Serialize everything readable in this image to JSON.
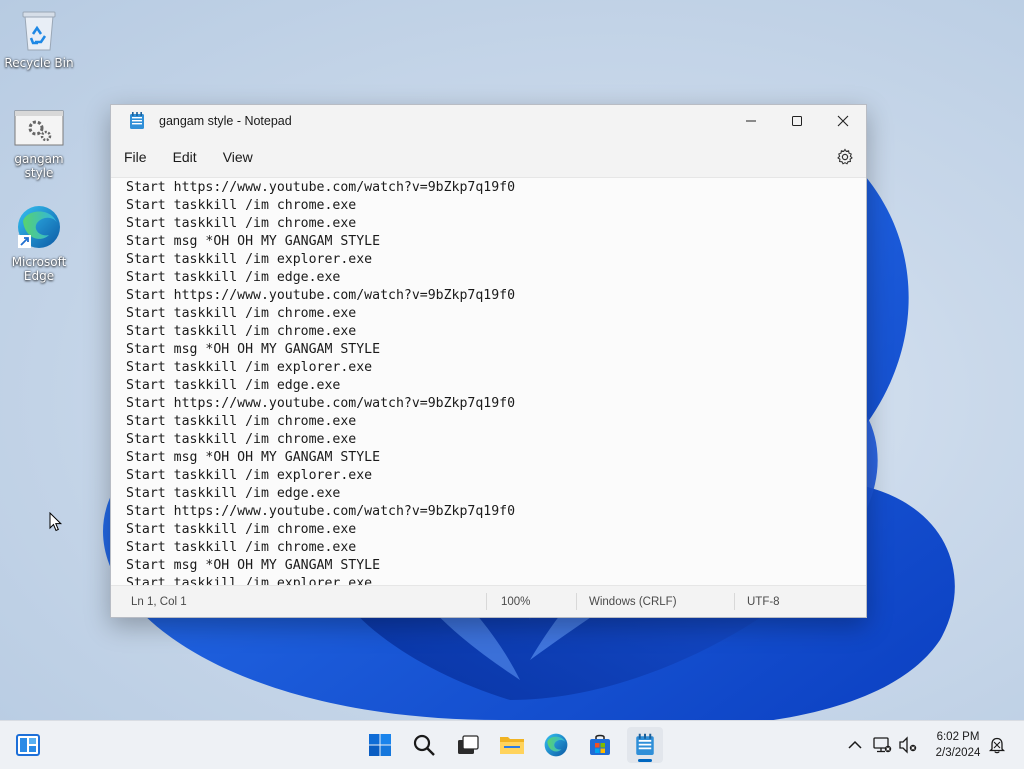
{
  "desktop": {
    "icons": [
      {
        "label": "Recycle Bin",
        "icon": "recycle-bin-icon"
      },
      {
        "label": "gangam style",
        "icon": "batch-file-icon"
      },
      {
        "label": "Microsoft Edge",
        "icon": "edge-icon"
      }
    ]
  },
  "window": {
    "title": "gangam style - Notepad",
    "app_icon": "notepad-icon",
    "controls": {
      "minimize": "minimize-icon",
      "maximize": "maximize-icon",
      "close": "close-icon"
    }
  },
  "menu": {
    "file": "File",
    "edit": "Edit",
    "view": "View",
    "settings_icon": "gear-icon"
  },
  "editor": {
    "lines": [
      "Start https://www.youtube.com/watch?v=9bZkp7q19f0",
      "Start taskkill /im chrome.exe",
      "Start taskkill /im chrome.exe",
      "Start msg *OH OH MY GANGAM STYLE",
      "Start taskkill /im explorer.exe",
      "Start taskkill /im edge.exe",
      "Start https://www.youtube.com/watch?v=9bZkp7q19f0",
      "Start taskkill /im chrome.exe",
      "Start taskkill /im chrome.exe",
      "Start msg *OH OH MY GANGAM STYLE",
      "Start taskkill /im explorer.exe",
      "Start taskkill /im edge.exe",
      "Start https://www.youtube.com/watch?v=9bZkp7q19f0",
      "Start taskkill /im chrome.exe",
      "Start taskkill /im chrome.exe",
      "Start msg *OH OH MY GANGAM STYLE",
      "Start taskkill /im explorer.exe",
      "Start taskkill /im edge.exe",
      "Start https://www.youtube.com/watch?v=9bZkp7q19f0",
      "Start taskkill /im chrome.exe",
      "Start taskkill /im chrome.exe",
      "Start msg *OH OH MY GANGAM STYLE",
      "Start taskkill /im explorer.exe"
    ]
  },
  "status": {
    "position": "Ln 1, Col 1",
    "zoom": "100%",
    "line_ending": "Windows (CRLF)",
    "encoding": "UTF-8"
  },
  "taskbar": {
    "apps": [
      "widgets-icon",
      "start-icon",
      "search-icon",
      "task-view-icon",
      "file-explorer-icon",
      "edge-icon",
      "store-icon",
      "notepad-icon"
    ],
    "tray": [
      "chevron-up-icon",
      "network-icon",
      "volume-muted-icon",
      "notification-icon"
    ],
    "time": "6:02 PM",
    "date": "2/3/2024"
  },
  "colors": {
    "accent": "#0067c0",
    "window_bg": "#f9f9f9",
    "taskbar_bg": "#eef1f5"
  }
}
